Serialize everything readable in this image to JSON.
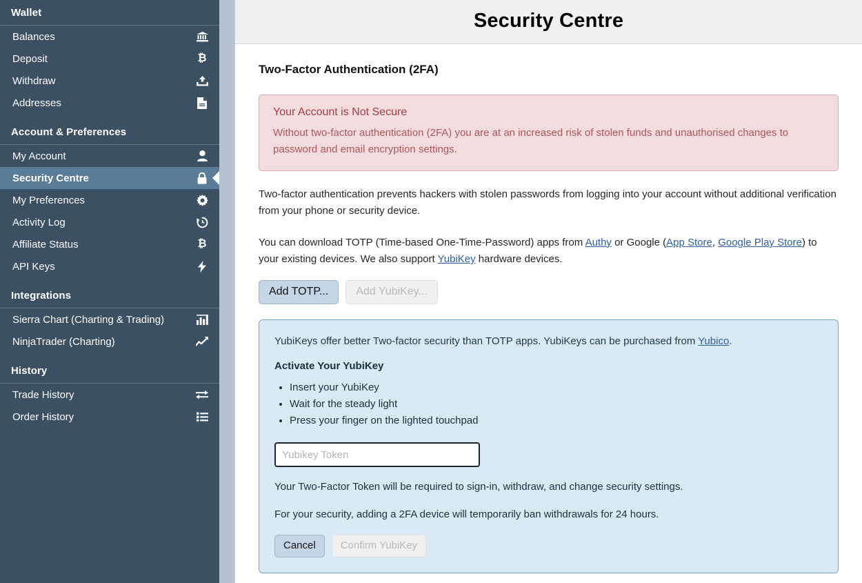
{
  "sidebar": {
    "sections": [
      {
        "title": "Wallet",
        "items": [
          {
            "label": "Balances",
            "icon": "bank-icon"
          },
          {
            "label": "Deposit",
            "icon": "bitcoin-icon"
          },
          {
            "label": "Withdraw",
            "icon": "upload-icon"
          },
          {
            "label": "Addresses",
            "icon": "document-icon"
          }
        ]
      },
      {
        "title": "Account & Preferences",
        "items": [
          {
            "label": "My Account",
            "icon": "user-icon",
            "active": false
          },
          {
            "label": "Security Centre",
            "icon": "lock-icon",
            "active": true
          },
          {
            "label": "My Preferences",
            "icon": "gear-icon",
            "active": false
          },
          {
            "label": "Activity Log",
            "icon": "history-icon",
            "active": false
          },
          {
            "label": "Affiliate Status",
            "icon": "bitcoin-icon",
            "active": false
          },
          {
            "label": "API Keys",
            "icon": "bolt-icon",
            "active": false
          }
        ]
      },
      {
        "title": "Integrations",
        "items": [
          {
            "label": "Sierra Chart (Charting & Trading)",
            "icon": "bar-chart-icon"
          },
          {
            "label": "NinjaTrader (Charting)",
            "icon": "line-chart-icon"
          }
        ]
      },
      {
        "title": "History",
        "items": [
          {
            "label": "Trade History",
            "icon": "exchange-icon"
          },
          {
            "label": "Order History",
            "icon": "list-icon"
          }
        ]
      }
    ]
  },
  "header": {
    "title": "Security Centre"
  },
  "main": {
    "section_title": "Two-Factor Authentication (2FA)",
    "alert": {
      "title": "Your Account is Not Secure",
      "text": "Without two-factor authentication (2FA) you are at an increased risk of stolen funds and unauthorised changes to password and email encryption settings."
    },
    "intro_paragraph": "Two-factor authentication prevents hackers with stolen passwords from logging into your account without additional verification from your phone or security device.",
    "download_paragraph": {
      "part1": "You can download TOTP (Time-based One-Time-Password) apps from ",
      "link_authy": "Authy",
      "part2": " or Google (",
      "link_app_store": "App Store",
      "part3": ", ",
      "link_google_play": "Google Play Store",
      "part4": ") to your existing devices. We also support ",
      "link_yubikey": "YubiKey",
      "part5": " hardware devices."
    },
    "buttons": {
      "add_totp": "Add TOTP...",
      "add_yubikey": "Add YubiKey..."
    },
    "yubikey_panel": {
      "lead_part1": "YubiKeys offer better Two-factor security than TOTP apps. YubiKeys can be purchased from ",
      "lead_link": "Yubico",
      "lead_part2": ".",
      "activate_title": "Activate Your YubiKey",
      "steps": [
        "Insert your YubiKey",
        "Wait for the steady light",
        "Press your finger on the lighted touchpad"
      ],
      "token_placeholder": "Yubikey Token",
      "token_value": "",
      "note1": "Your Two-Factor Token will be required to sign-in, withdraw, and change security settings.",
      "note2": "For your security, adding a 2FA device will temporarily ban withdrawals for 24 hours.",
      "cancel_label": "Cancel",
      "confirm_label": "Confirm YubiKey"
    }
  },
  "colors": {
    "sidebar_bg": "#3b5063",
    "sidebar_active": "#5b7c96",
    "alert_bg": "#f3dcdd",
    "alert_border": "#d9a9ad",
    "alert_text": "#a94442",
    "info_bg": "#d9eaf4",
    "info_border": "#6fa8cc",
    "link": "#2b5fa8",
    "button_primary": "#c4d6e6"
  }
}
